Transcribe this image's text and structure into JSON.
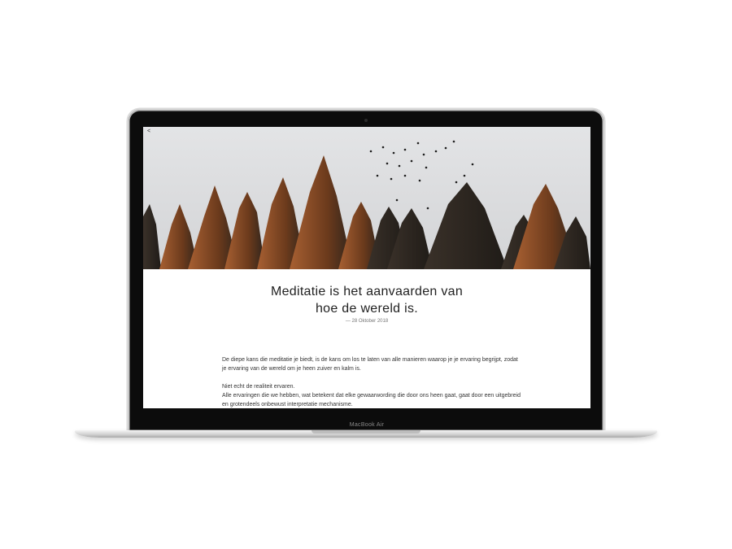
{
  "device": {
    "label": "MacBook Air"
  },
  "page": {
    "nav": {
      "back_icon": "back-arrow-icon",
      "back_glyph": "<"
    },
    "title_line1": "Meditatie is het aanvaarden van",
    "title_line2": "hoe de wereld is.",
    "date": "— 28 Oktober 2018",
    "paragraphs": [
      "De diepe kans die meditatie je biedt, is de kans om los te laten van alle manieren waarop je je ervaring begrijpt, zodat je ervaring van de wereld om je heen zuiver en kalm is.",
      "Niet echt de realiteit ervaren.",
      "Alle ervaringen die we hebben, wat betekent dat elke gewaarwording die door ons heen gaat, gaat door een uitgebreid en grotendeels onbewust interpretatie mechanisme."
    ]
  },
  "colors": {
    "sky": "#dcdddf",
    "tree_dark": "#2f2a24",
    "tree_warm": "#8a4f24"
  }
}
